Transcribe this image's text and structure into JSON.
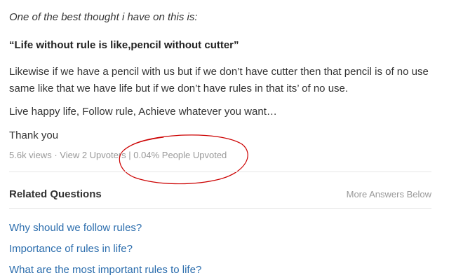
{
  "answer": {
    "intro": "One of the best thought i have on this is:",
    "quote": "“Life without rule is like,pencil without cutter”",
    "body": "Likewise if we have a pencil with us but if we don’t have cutter then that pencil is of no use same like that we have life but if we don’t have rules in that its’ of no use.",
    "live": "Live happy life, Follow rule, Achieve whatever you want…",
    "thanks": "Thank you"
  },
  "meta": {
    "views": "5.6k views",
    "separator1": " · ",
    "upvotes_link": "View 2 Upvoters",
    "separator2": " | ",
    "percent": "0.04% People Upvoted"
  },
  "annotation": {
    "color": "#cc0000",
    "shape": "hand-drawn ellipse"
  },
  "related": {
    "title": "Related Questions",
    "more_label": "More Answers Below",
    "questions": [
      "Why should we follow rules?",
      "Importance of rules in life?",
      "What are the most important rules to life?"
    ]
  },
  "colors": {
    "link": "#2b6dad",
    "meta": "#999999",
    "text": "#333333"
  }
}
